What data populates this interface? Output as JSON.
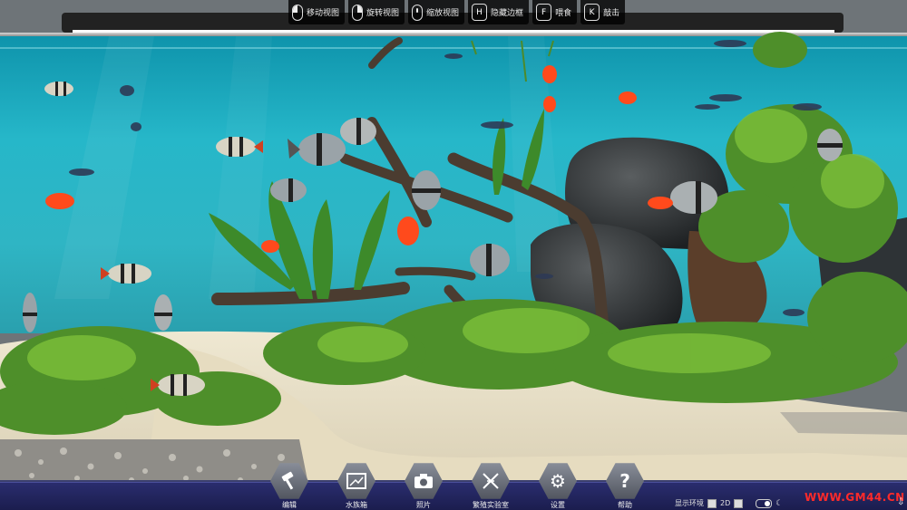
{
  "controls_hint": [
    {
      "icon": "mouse-left-icon",
      "label": "移动视图"
    },
    {
      "icon": "mouse-right-icon",
      "label": "旋转视图"
    },
    {
      "icon": "mouse-wheel-icon",
      "label": "缩放视图"
    },
    {
      "key": "H",
      "label": "隐藏边框"
    },
    {
      "key": "F",
      "label": "喂食"
    },
    {
      "key": "K",
      "label": "敲击"
    }
  ],
  "toolbar": [
    {
      "icon": "hammer-icon",
      "label": "编辑"
    },
    {
      "icon": "aquarium-icon",
      "label": "水族箱"
    },
    {
      "icon": "camera-icon",
      "label": "照片"
    },
    {
      "icon": "dna-icon",
      "label": "繁殖实验室"
    },
    {
      "icon": "gear-icon",
      "label": "设置"
    },
    {
      "icon": "question-icon",
      "label": "帮助"
    }
  ],
  "display_options": {
    "environment_label": "显示环境",
    "mode_2d_label": "2D"
  },
  "watermark": "WWW.GM44.CN",
  "colors": {
    "water": "#1fa9bd",
    "bottom_bar": "#23265e",
    "watermark": "#ff2a2a"
  }
}
